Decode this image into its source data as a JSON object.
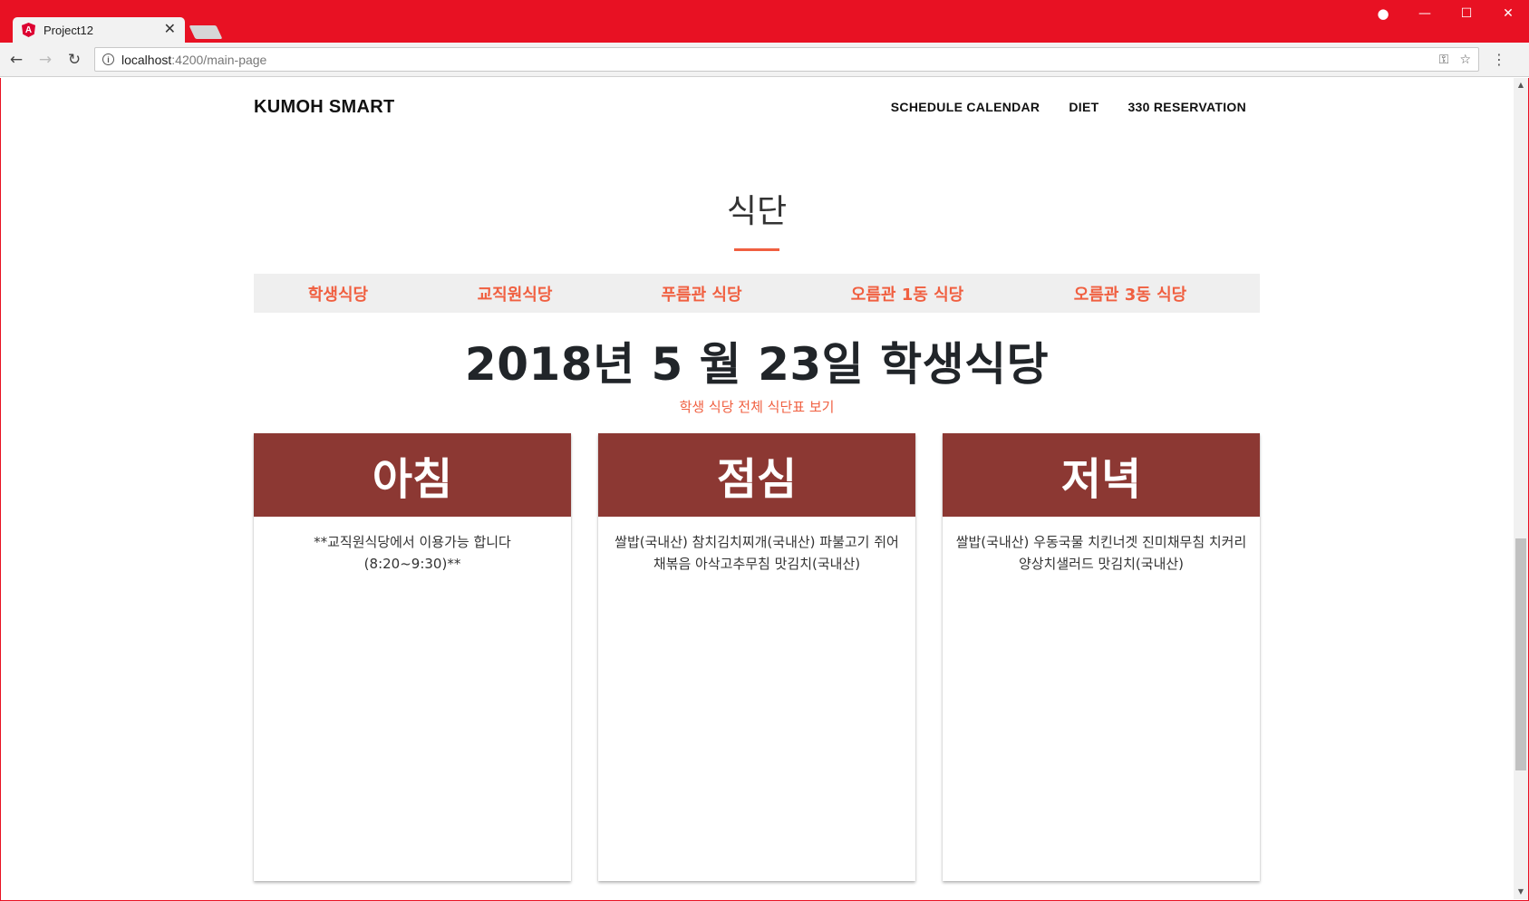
{
  "browser": {
    "tab_title": "Project12",
    "tab_favicon": "A",
    "url_host": "localhost",
    "url_path": ":4200/main-page"
  },
  "site": {
    "brand": "KUMOH SMART",
    "nav": [
      "SCHEDULE CALENDAR",
      "DIET",
      "330 RESERVATION"
    ]
  },
  "section": {
    "title": "식단"
  },
  "cafeteria_tabs": [
    "학생식당",
    "교직원식당",
    "푸름관 식당",
    "오름관 1동 식당",
    "오름관 3동 식당"
  ],
  "date_heading": "2018년 5 월 23일 학생식당",
  "full_menu_link": "학생 식당 전체 식단표 보기",
  "meals": [
    {
      "name": "아침",
      "menu": "**교직원식당에서 이용가능 합니다(8:20~9:30)**"
    },
    {
      "name": "점심",
      "menu": "쌀밥(국내산) 참치김치찌개(국내산) 파불고기 쥐어채볶음 아삭고추무침 맛김치(국내산)"
    },
    {
      "name": "저녁",
      "menu": "쌀밥(국내산) 우동국물 치킨너겟 진미채무침 치커리양상치샐러드 맛김치(국내산)"
    }
  ],
  "colors": {
    "browser_frame": "#e81123",
    "accent": "#f05f40",
    "meal_header": "#8c3833",
    "tab_bar": "#efefef"
  }
}
